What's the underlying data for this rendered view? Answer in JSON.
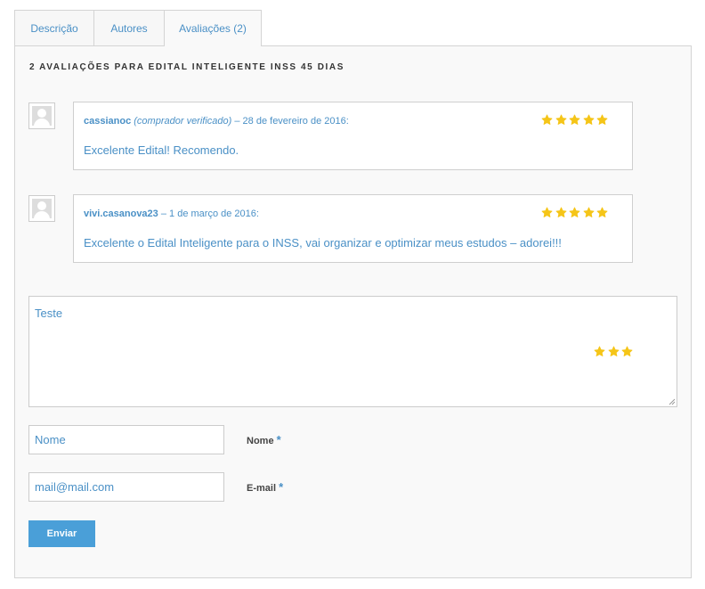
{
  "tabs": [
    {
      "label": "Descrição",
      "active": false
    },
    {
      "label": "Autores",
      "active": false
    },
    {
      "label": "Avaliações (2)",
      "active": true
    }
  ],
  "reviews_title": "2 AVALIAÇÕES PARA EDITAL INTELIGENTE INSS 45 DIAS",
  "reviews": [
    {
      "author": "cassianoc",
      "verified": "(comprador verificado)",
      "date": "– 28 de fevereiro de 2016:",
      "text": "Excelente Edital! Recomendo.",
      "rating": 5
    },
    {
      "author": "vivi.casanova23",
      "verified": "",
      "date": "– 1 de março de 2016:",
      "text": "Excelente o Edital Inteligente para o INSS, vai organizar e optimizar meus estudos – adorei!!!",
      "rating": 5
    }
  ],
  "form": {
    "comment_value": "Teste",
    "selected_rating": 3,
    "name_value": "Nome",
    "name_label": "Nome",
    "email_value": "mail@mail.com",
    "email_label": "E-mail",
    "required_mark": "*",
    "submit_label": "Enviar"
  },
  "colors": {
    "accent": "#4a90c6",
    "button": "#4a9fd8",
    "star": "#f5c518"
  },
  "icons": [
    "avatar-placeholder-icon",
    "star-icon",
    "resize-grip-icon"
  ]
}
